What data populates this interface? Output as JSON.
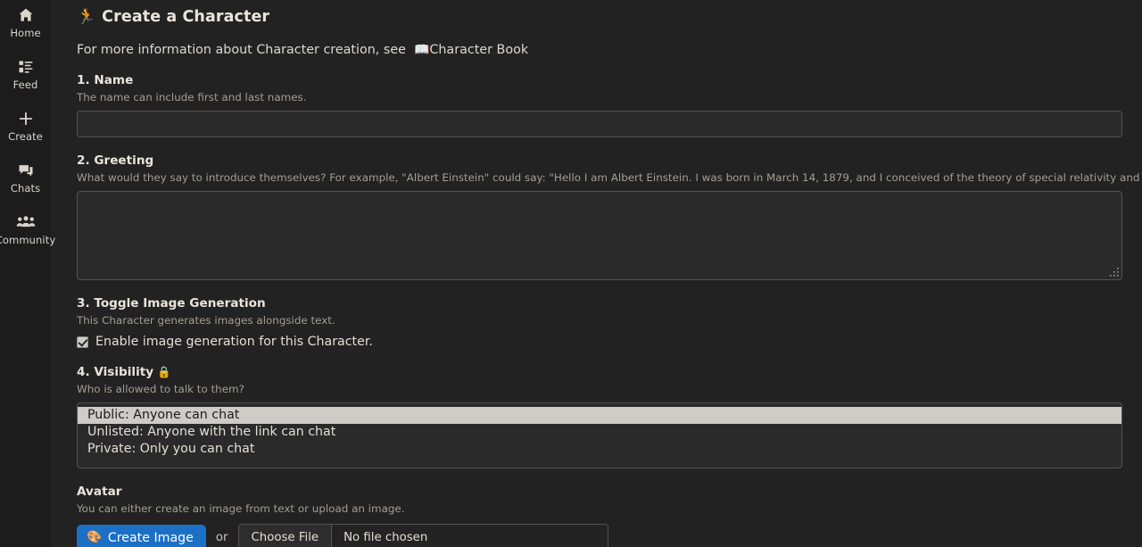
{
  "sidebar": {
    "items": [
      {
        "label": "Home",
        "icon": "home-icon"
      },
      {
        "label": "Feed",
        "icon": "feed-icon"
      },
      {
        "label": "Create",
        "icon": "plus-icon"
      },
      {
        "label": "Chats",
        "icon": "chat-bubbles-icon"
      },
      {
        "label": "Community",
        "icon": "people-group-icon"
      }
    ]
  },
  "header": {
    "icon": "🏃",
    "title": "Create a Character"
  },
  "info": {
    "text": "For more information about Character creation, see",
    "book_icon": "📖",
    "link_label": "Character Book"
  },
  "name_section": {
    "title": "1. Name",
    "help": "The name can include first and last names.",
    "value": "",
    "placeholder": ""
  },
  "greeting_section": {
    "title": "2. Greeting",
    "help": "What would they say to introduce themselves? For example, \"Albert Einstein\" could say: \"Hello I am Albert Einstein. I was born in March 14, 1879, and I conceived of the theory of special relativity and general relativity.\"",
    "value": "",
    "placeholder": ""
  },
  "image_section": {
    "title": "3. Toggle Image Generation",
    "help": "This Character generates images alongside text.",
    "checkbox_label": "Enable image generation for this Character.",
    "checked": true
  },
  "visibility_section": {
    "title": "4. Visibility",
    "lock_icon": "🔒",
    "help": "Who is allowed to talk to them?",
    "options": [
      "Public: Anyone can chat",
      "Unlisted: Anyone with the link can chat",
      "Private: Only you can chat"
    ],
    "selected_index": 0
  },
  "avatar_section": {
    "title": "Avatar",
    "help": "You can either create an image from text or upload an image.",
    "create_button_label": "Create Image",
    "create_button_emoji": "🎨",
    "or_label": "or",
    "choose_file_label": "Choose File",
    "file_status": "No file chosen"
  },
  "colors": {
    "sidebar_bg": "#1c1c1c",
    "main_bg": "#222222",
    "accent_blue": "#1b6fc4",
    "heading": "#e9e4dd",
    "help_text": "#a49e94",
    "selection_bg": "#cfccc7"
  }
}
